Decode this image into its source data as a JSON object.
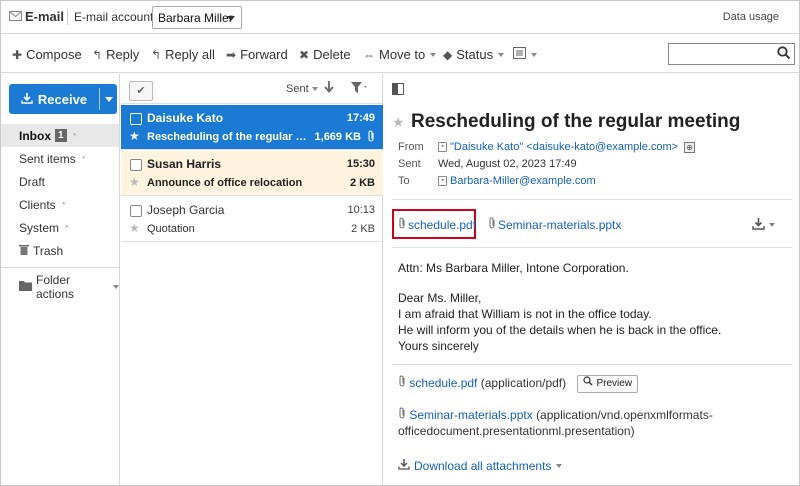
{
  "app": {
    "title": "E-mail",
    "account_label": "E-mail account:",
    "account_value": "Barbara Miller",
    "data_usage": "Data usage"
  },
  "toolbar": {
    "compose": "Compose",
    "reply": "Reply",
    "reply_all": "Reply all",
    "forward": "Forward",
    "delete": "Delete",
    "move_to": "Move to",
    "status": "Status",
    "search_placeholder": ""
  },
  "sidebar": {
    "receive": "Receive",
    "items": [
      {
        "label": "Inbox",
        "badge": "1"
      },
      {
        "label": "Sent items"
      },
      {
        "label": "Draft"
      },
      {
        "label": "Clients"
      },
      {
        "label": "System"
      },
      {
        "label": "Trash"
      }
    ],
    "folder_actions": "Folder actions"
  },
  "list": {
    "sort_label": "Sent",
    "messages": [
      {
        "from": "Daisuke Kato",
        "time": "17:49",
        "subject": "Rescheduling of the regular me...",
        "size": "1,669 KB",
        "state": "selected"
      },
      {
        "from": "Susan Harris",
        "time": "15:30",
        "subject": "Announce of office relocation",
        "size": "2 KB",
        "state": "unread"
      },
      {
        "from": "Joseph Garcia",
        "time": "10:13",
        "subject": "Quotation",
        "size": "2 KB",
        "state": "read"
      }
    ]
  },
  "reader": {
    "title": "Rescheduling of the regular meeting",
    "from_label": "From",
    "from_value": "\"Daisuke Kato\" <daisuke-kato@example.com>",
    "sent_label": "Sent",
    "sent_value": "Wed, August 02, 2023 17:49",
    "to_label": "To",
    "to_value": "Barbara-Miller@example.com",
    "attachments": [
      {
        "name": "schedule.pdf",
        "type": "(application/pdf)"
      },
      {
        "name": "Seminar-materials.pptx",
        "type": "(application/vnd.openxmlformats-",
        "type_cont": "officedocument.presentationml.presentation)"
      }
    ],
    "body": [
      "Attn: Ms Barbara Miller, Intone Corporation.",
      "Dear Ms. Miller,",
      "I am afraid that William is not in the office today.",
      "He will inform you of the details when he is back in the office.",
      "Yours sincerely"
    ],
    "preview": "Preview",
    "download_all": "Download all attachments"
  },
  "colors": {
    "accent": "#1a7ad4",
    "unread_bg": "#fdf3de",
    "link": "#1560bd",
    "highlight": "#d0021b"
  }
}
